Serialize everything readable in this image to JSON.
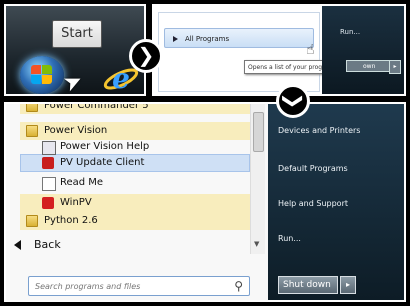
{
  "taskbar": {
    "start_tooltip": "Start",
    "start_orb_icon": "windows-logo-icon",
    "browser_icon": "internet-explorer-icon"
  },
  "all_programs_view": {
    "all_programs_label": "All Programs",
    "tooltip": "Opens a list of your programs.",
    "run_label": "Run...",
    "shutdown_label": "own"
  },
  "programs": [
    {
      "label": "Power Commander 5",
      "icon": "folder-icon",
      "state": "folder"
    },
    {
      "label": "Power Vision",
      "icon": "folder-icon",
      "state": "folder-open"
    },
    {
      "label": "Power Vision Help",
      "icon": "help-file-icon",
      "state": "normal"
    },
    {
      "label": "PV Update Client",
      "icon": "update-client-icon",
      "state": "selected"
    },
    {
      "label": "Read Me",
      "icon": "document-icon",
      "state": "normal"
    },
    {
      "label": "WinPV",
      "icon": "winpv-icon",
      "state": "highlight"
    },
    {
      "label": "Python 2.6",
      "icon": "folder-icon",
      "state": "folder"
    }
  ],
  "back_label": "Back",
  "search": {
    "placeholder": "Search programs and files"
  },
  "right_links": [
    "Devices and Printers",
    "Default Programs",
    "Help and Support",
    "Run..."
  ],
  "shutdown": {
    "label": "Shut down",
    "arrow": "▸"
  },
  "colors": {
    "accent_blue": "#cfe0f5",
    "folder_highlight": "#f8edbd",
    "right_pane": "#1f3a4e"
  }
}
